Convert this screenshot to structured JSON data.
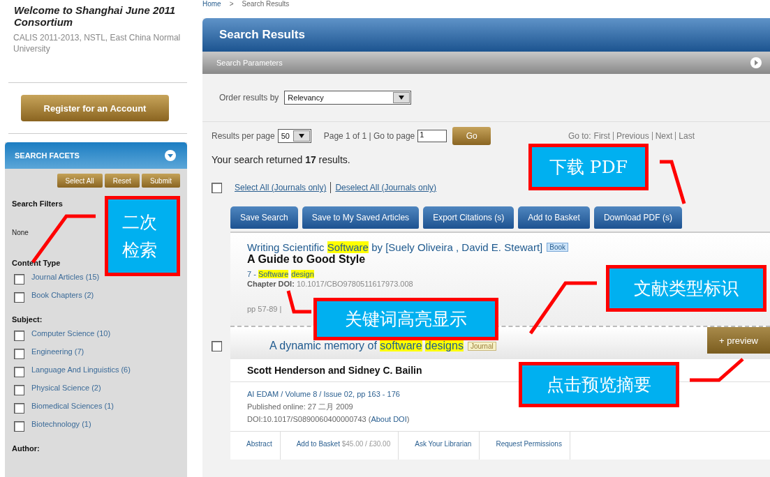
{
  "sidebar": {
    "welcome": "Welcome to Shanghai June 2011 Consortium",
    "institutions": "CALIS 2011-2013, NSTL, East China Normal University",
    "register_button": "Register for an Account",
    "facets": {
      "title": "SEARCH FACETS",
      "buttons": [
        "Select All",
        "Reset",
        "Submit"
      ],
      "groups": [
        {
          "heading": "Search Filters",
          "empty_text": "None"
        },
        {
          "heading": "Content Type",
          "items": [
            {
              "label": "Journal Articles (15)",
              "checked": false
            },
            {
              "label": "Book Chapters (2)",
              "checked": false
            }
          ]
        },
        {
          "heading": "Subject:",
          "items": [
            {
              "label": "Computer Science (10)",
              "checked": false
            },
            {
              "label": "Engineering (7)",
              "checked": false
            },
            {
              "label": "Language And Linguistics (6)",
              "checked": false
            },
            {
              "label": "Physical Science (2)",
              "checked": false
            },
            {
              "label": "Biomedical Sciences (1)",
              "checked": false
            },
            {
              "label": "Biotechnology (1)",
              "checked": false
            }
          ]
        },
        {
          "heading": "Author:"
        }
      ]
    }
  },
  "breadcrumb": [
    "Home",
    ">",
    "Search Results"
  ],
  "main": {
    "title": "Search Results",
    "parameters_label": "Search Parameters",
    "order_label": "Order results by",
    "order_value": "Relevancy",
    "per_page_label": "Results per page",
    "per_page_value": "50",
    "page_info": "Page 1 of 1 | Go to page",
    "page_input": "1",
    "go_button": "Go",
    "goto_label": "Go to:",
    "goto_links": [
      "First",
      "Previous",
      "Next",
      "Last"
    ],
    "summary": "Your search returned **17** results.",
    "select_all": {
      "checked": false,
      "links": [
        "Select All (Journals only)",
        "Deselect All (Journals only)"
      ]
    },
    "actions": [
      "Save Search",
      "Save to My Saved Articles",
      "Export Citations (s)",
      "Add to Basket",
      "Download PDF (s)"
    ],
    "results": [
      {
        "kind": "book",
        "title": [
          {
            "text": "Writing Scientific ",
            "highlighted": false
          },
          {
            "text": "Software",
            "highlighted": true
          },
          {
            "text": " by [Suely Oliveira , David E. Stewart]",
            "highlighted": false
          }
        ],
        "badge": {
          "label": "Book",
          "kind": "book"
        },
        "subtitle": "A Guide to Good Style",
        "chapter": [
          {
            "text": "7 - ",
            "highlighted": false
          },
          {
            "text": "Software",
            "highlighted": true
          },
          {
            "text": "design",
            "highlighted": true
          }
        ],
        "doi": "**Chapter DOI:** 10.1017/CBO9780511617973.008",
        "pages": "pp 57-89 |"
      },
      {
        "kind": "journal",
        "checked": false,
        "title": [
          {
            "text": "A dynamic memory of ",
            "highlighted": false
          },
          {
            "text": "software",
            "highlighted": true
          },
          {
            "text": "designs",
            "highlighted": true
          }
        ],
        "badge": {
          "label": "Journal",
          "kind": "journal"
        },
        "preview_button": "+ preview",
        "authors": "Scott Henderson and Sidney C. Bailin",
        "citation": "AI EDAM / Volume 8 / Issue 02, pp 163 - 176",
        "published": "Published online: 27 二月 2009",
        "doi": "DOI:10.1017/S0890060400000743 (",
        "doi_link": "About DOI",
        "doi_end": ")",
        "links": [
          {
            "label": "Abstract"
          },
          {
            "label": "Add to Basket",
            "price": "$45.00 / £30.00"
          },
          {
            "label": "Ask Your Librarian"
          },
          {
            "label": "Request Permissions"
          }
        ]
      }
    ]
  },
  "annotations": [
    {
      "text": "二次检索"
    },
    {
      "text": "下载 PDF"
    },
    {
      "text": "文献类型标识"
    },
    {
      "text": "关键词高亮显示"
    },
    {
      "text": "点击预览摘要"
    }
  ]
}
